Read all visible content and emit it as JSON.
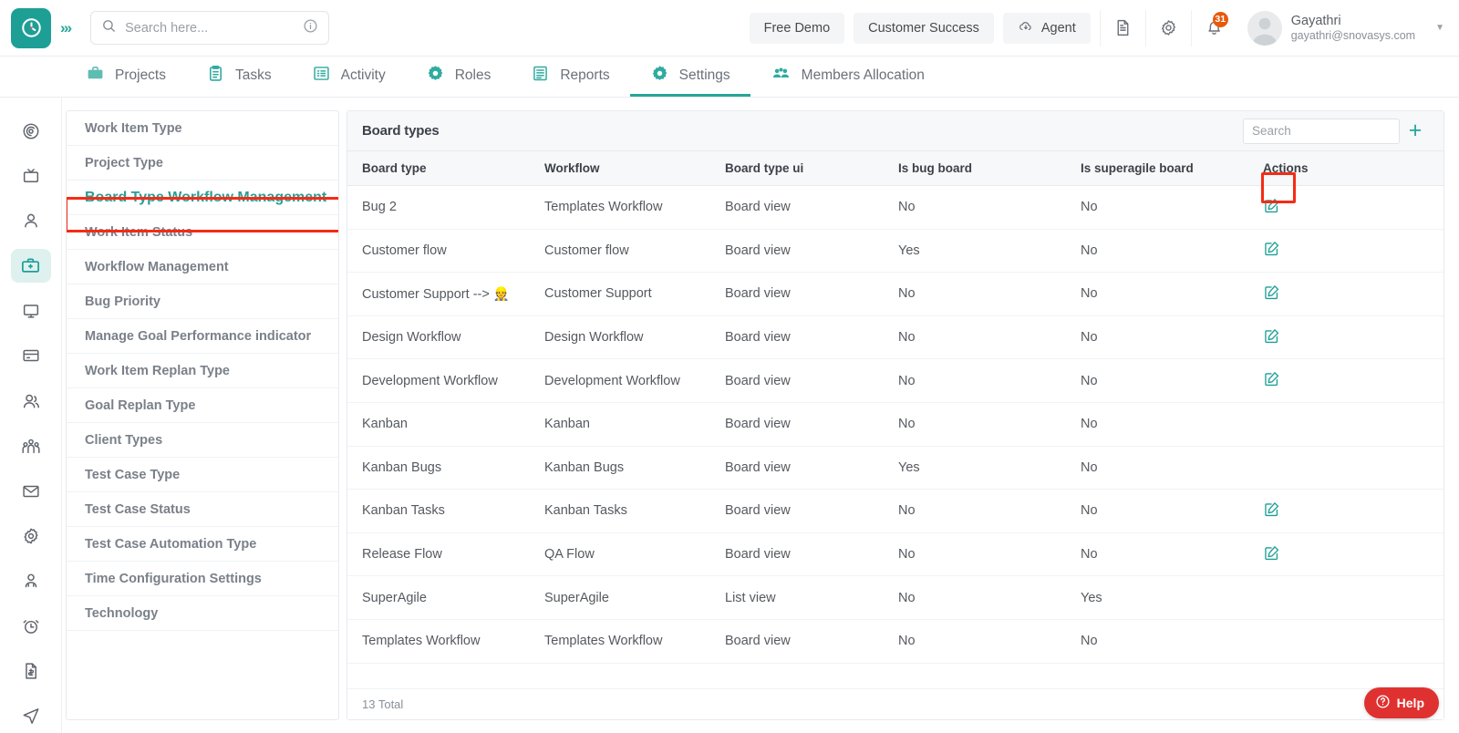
{
  "brand": {
    "accent": "#1d9f96",
    "accent_light": "#26a69a",
    "annotation_red": "#f52b16",
    "help_red": "#e03131",
    "badge_orange": "#e8590c"
  },
  "header": {
    "logo_icon": "clock-logo-icon",
    "expand_icon": "double-chevron-right-icon",
    "search": {
      "placeholder": "Search here...",
      "value": "",
      "icon": "search-icon",
      "info_icon": "info-circle-icon"
    },
    "buttons": [
      {
        "label": "Free Demo",
        "name": "free-demo-button",
        "icon": ""
      },
      {
        "label": "Customer Success",
        "name": "customer-success-button",
        "icon": ""
      },
      {
        "label": "Agent",
        "name": "agent-button",
        "icon": "cloud-download-icon"
      }
    ],
    "icons": [
      {
        "name": "document-icon"
      },
      {
        "name": "gear-icon"
      },
      {
        "name": "bell-icon",
        "badge": "31"
      }
    ],
    "user": {
      "name": "Gayathri",
      "email": "gayathri@snovasys.com",
      "avatar": "avatar",
      "caret": "chevron-down-icon"
    }
  },
  "nav": {
    "tabs": [
      {
        "label": "Projects",
        "icon": "briefcase-icon",
        "active": false
      },
      {
        "label": "Tasks",
        "icon": "clipboard-icon",
        "active": false
      },
      {
        "label": "Activity",
        "icon": "list-box-icon",
        "active": false
      },
      {
        "label": "Roles",
        "icon": "gear-target-icon",
        "active": false
      },
      {
        "label": "Reports",
        "icon": "report-lines-icon",
        "active": false
      },
      {
        "label": "Settings",
        "icon": "gear-icon",
        "active": true
      },
      {
        "label": "Members Allocation",
        "icon": "people-group-icon",
        "active": false
      }
    ]
  },
  "rail": {
    "items": [
      {
        "name": "rail-dashboard-icon",
        "active": false
      },
      {
        "name": "rail-tv-icon",
        "active": false
      },
      {
        "name": "rail-user-icon",
        "active": false
      },
      {
        "name": "rail-briefcase-icon",
        "active": true
      },
      {
        "name": "rail-monitor-icon",
        "active": false
      },
      {
        "name": "rail-card-icon",
        "active": false
      },
      {
        "name": "rail-users-icon",
        "active": false
      },
      {
        "name": "rail-team-icon",
        "active": false
      },
      {
        "name": "rail-mail-icon",
        "active": false
      },
      {
        "name": "rail-settings-icon",
        "active": false
      },
      {
        "name": "rail-contact-icon",
        "active": false
      },
      {
        "name": "rail-alarm-icon",
        "active": false
      },
      {
        "name": "rail-invoice-icon",
        "active": false
      },
      {
        "name": "rail-send-icon",
        "active": false
      }
    ]
  },
  "settings_menu": {
    "items": [
      {
        "label": "Work Item Type",
        "selected": false
      },
      {
        "label": "Project Type",
        "selected": false
      },
      {
        "label": "Board Type Workflow Management",
        "selected": true
      },
      {
        "label": "Work Item Status",
        "selected": false
      },
      {
        "label": "Workflow Management",
        "selected": false
      },
      {
        "label": "Bug Priority",
        "selected": false
      },
      {
        "label": "Manage Goal Performance indicator",
        "selected": false
      },
      {
        "label": "Work Item Replan Type",
        "selected": false
      },
      {
        "label": "Goal Replan Type",
        "selected": false
      },
      {
        "label": "Client Types",
        "selected": false
      },
      {
        "label": "Test Case Type",
        "selected": false
      },
      {
        "label": "Test Case Status",
        "selected": false
      },
      {
        "label": "Test Case Automation Type",
        "selected": false
      },
      {
        "label": "Time Configuration Settings",
        "selected": false
      },
      {
        "label": "Technology",
        "selected": false
      }
    ]
  },
  "panel": {
    "title": "Board types",
    "search": {
      "placeholder": "Search",
      "value": ""
    },
    "add_button": "+",
    "columns": [
      "Board type",
      "Workflow",
      "Board type ui",
      "Is bug board",
      "Is superagile board",
      "Actions"
    ],
    "rows": [
      {
        "board_type": "Bug 2",
        "workflow": "Templates Workflow",
        "board_type_ui": "Board view",
        "is_bug_board": "No",
        "is_superagile_board": "No",
        "action": "edit-icon",
        "highlighted": true
      },
      {
        "board_type": "Customer flow",
        "workflow": "Customer flow",
        "board_type_ui": "Board view",
        "is_bug_board": "Yes",
        "is_superagile_board": "No",
        "action": "edit-icon",
        "highlighted": false
      },
      {
        "board_type": "Customer Support --> 👷",
        "workflow": "Customer Support",
        "board_type_ui": "Board view",
        "is_bug_board": "No",
        "is_superagile_board": "No",
        "action": "edit-icon",
        "highlighted": false
      },
      {
        "board_type": "Design Workflow",
        "workflow": "Design Workflow",
        "board_type_ui": "Board view",
        "is_bug_board": "No",
        "is_superagile_board": "No",
        "action": "edit-icon",
        "highlighted": false
      },
      {
        "board_type": "Development Workflow",
        "workflow": "Development Workflow",
        "board_type_ui": "Board view",
        "is_bug_board": "No",
        "is_superagile_board": "No",
        "action": "edit-icon",
        "highlighted": false
      },
      {
        "board_type": "Kanban",
        "workflow": "Kanban",
        "board_type_ui": "Board view",
        "is_bug_board": "No",
        "is_superagile_board": "No",
        "action": "",
        "highlighted": false
      },
      {
        "board_type": "Kanban Bugs",
        "workflow": "Kanban Bugs",
        "board_type_ui": "Board view",
        "is_bug_board": "Yes",
        "is_superagile_board": "No",
        "action": "",
        "highlighted": false
      },
      {
        "board_type": "Kanban Tasks",
        "workflow": "Kanban Tasks",
        "board_type_ui": "Board view",
        "is_bug_board": "No",
        "is_superagile_board": "No",
        "action": "edit-icon",
        "highlighted": false
      },
      {
        "board_type": "Release Flow",
        "workflow": "QA Flow",
        "board_type_ui": "Board view",
        "is_bug_board": "No",
        "is_superagile_board": "No",
        "action": "edit-icon",
        "highlighted": false
      },
      {
        "board_type": "SuperAgile",
        "workflow": "SuperAgile",
        "board_type_ui": "List view",
        "is_bug_board": "No",
        "is_superagile_board": "Yes",
        "action": "",
        "highlighted": false
      },
      {
        "board_type": "Templates Workflow",
        "workflow": "Templates Workflow",
        "board_type_ui": "Board view",
        "is_bug_board": "No",
        "is_superagile_board": "No",
        "action": "",
        "highlighted": false
      }
    ],
    "footer_total": "13 Total"
  },
  "help": {
    "label": "Help",
    "icon": "question-circle-icon"
  }
}
